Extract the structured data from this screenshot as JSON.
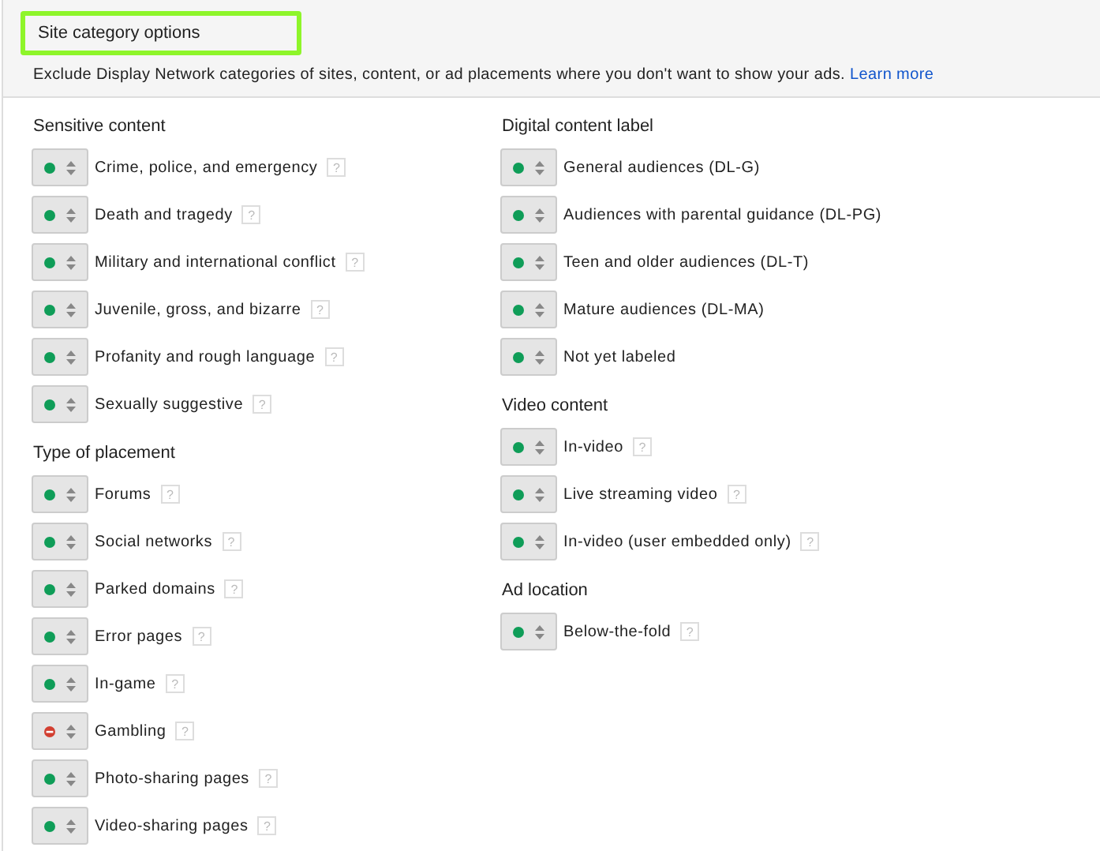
{
  "title": "Site category options",
  "description": "Exclude Display Network categories of sites, content, or ad placements where you don't want to show your ads.",
  "learn_more": "Learn more",
  "columns": [
    [
      {
        "heading": "Sensitive content",
        "items": [
          {
            "label": "Crime, police, and emergency",
            "excluded": false,
            "help": "?"
          },
          {
            "label": "Death and tragedy",
            "excluded": false,
            "help": "?"
          },
          {
            "label": "Military and international conflict",
            "excluded": false,
            "help": "?"
          },
          {
            "label": "Juvenile, gross, and bizarre",
            "excluded": false,
            "help": "?"
          },
          {
            "label": "Profanity and rough language",
            "excluded": false,
            "help": "?"
          },
          {
            "label": "Sexually suggestive",
            "excluded": false,
            "help": "?"
          }
        ]
      },
      {
        "heading": "Type of placement",
        "items": [
          {
            "label": "Forums",
            "excluded": false,
            "help": "?"
          },
          {
            "label": "Social networks",
            "excluded": false,
            "help": "?"
          },
          {
            "label": "Parked domains",
            "excluded": false,
            "help": "?"
          },
          {
            "label": "Error pages",
            "excluded": false,
            "help": "?"
          },
          {
            "label": "In-game",
            "excluded": false,
            "help": "?"
          },
          {
            "label": "Gambling",
            "excluded": true,
            "help": "?"
          },
          {
            "label": "Photo-sharing pages",
            "excluded": false,
            "help": "?"
          },
          {
            "label": "Video-sharing pages",
            "excluded": false,
            "help": "?"
          }
        ]
      }
    ],
    [
      {
        "heading": "Digital content label",
        "items": [
          {
            "label": "General audiences (DL-G)",
            "excluded": false
          },
          {
            "label": "Audiences with parental guidance (DL-PG)",
            "excluded": false
          },
          {
            "label": "Teen and older audiences (DL-T)",
            "excluded": false
          },
          {
            "label": "Mature audiences (DL-MA)",
            "excluded": false
          },
          {
            "label": "Not yet labeled",
            "excluded": false
          }
        ]
      },
      {
        "heading": "Video content",
        "items": [
          {
            "label": "In-video",
            "excluded": false,
            "help": "?"
          },
          {
            "label": "Live streaming video",
            "excluded": false,
            "help": "?"
          },
          {
            "label": "In-video (user embedded only)",
            "excluded": false,
            "help": "?"
          }
        ]
      },
      {
        "heading": "Ad location",
        "items": [
          {
            "label": "Below-the-fold",
            "excluded": false,
            "help": "?"
          }
        ]
      }
    ]
  ]
}
